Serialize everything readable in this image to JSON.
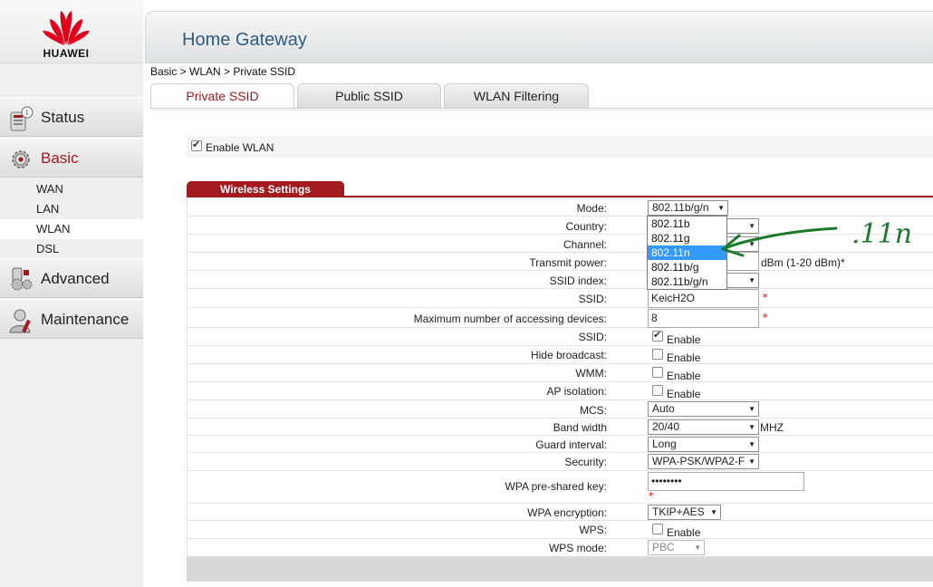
{
  "brand": "HUAWEI",
  "header": {
    "title": "Home Gateway"
  },
  "breadcrumb": "Basic > WLAN > Private SSID",
  "sidebar": {
    "status": "Status",
    "basic": "Basic",
    "sub": [
      "WAN",
      "LAN",
      "WLAN",
      "DSL"
    ],
    "advanced": "Advanced",
    "maintenance": "Maintenance"
  },
  "tabs": [
    "Private SSID",
    "Public SSID",
    "WLAN Filtering"
  ],
  "enable_wlan": {
    "label": "Enable WLAN",
    "checked": true
  },
  "section_title": "Wireless Settings",
  "form": {
    "mode": {
      "label": "Mode:",
      "value": "802.11b/g/n"
    },
    "mode_options": [
      "802.11b",
      "802.11g",
      "802.11n",
      "802.11b/g",
      "802.11b/g/n"
    ],
    "mode_highlighted": "802.11n",
    "country": {
      "label": "Country:"
    },
    "channel": {
      "label": "Channel:"
    },
    "transmit_power": {
      "label": "Transmit power:",
      "unit": "dBm (1-20 dBm)*"
    },
    "ssid_index": {
      "label": "SSID index:"
    },
    "ssid_name": {
      "label": "SSID:",
      "value": "KeicH2O",
      "required": "*"
    },
    "max_devices": {
      "label": "Maximum number of accessing devices:",
      "value": "8",
      "required": "*"
    },
    "ssid_enable": {
      "label": "SSID:",
      "enable": "Enable",
      "checked": true
    },
    "hide_broadcast": {
      "label": "Hide broadcast:",
      "enable": "Enable",
      "checked": false
    },
    "wmm": {
      "label": "WMM:",
      "enable": "Enable",
      "checked": false
    },
    "ap_isolation": {
      "label": "AP isolation:",
      "enable": "Enable",
      "checked": false
    },
    "mcs": {
      "label": "MCS:",
      "value": "Auto"
    },
    "band_width": {
      "label": "Band width",
      "value": "20/40",
      "unit": "MHZ"
    },
    "guard_interval": {
      "label": "Guard interval:",
      "value": "Long"
    },
    "security": {
      "label": "Security:",
      "value": "WPA-PSK/WPA2-F"
    },
    "wpa_key": {
      "label": "WPA pre-shared key:",
      "value": "••••••••",
      "required": "*"
    },
    "wpa_encryption": {
      "label": "WPA encryption:",
      "value": "TKIP+AES"
    },
    "wps": {
      "label": "WPS:",
      "enable": "Enable",
      "checked": false
    },
    "wps_mode": {
      "label": "WPS mode:",
      "value": "PBC"
    }
  },
  "annotation": {
    "text": ".11n",
    "color": "#1a7a2a"
  },
  "colors": {
    "accent": "#a31a1f",
    "title": "#2f5c86",
    "highlight": "#3399ff"
  }
}
